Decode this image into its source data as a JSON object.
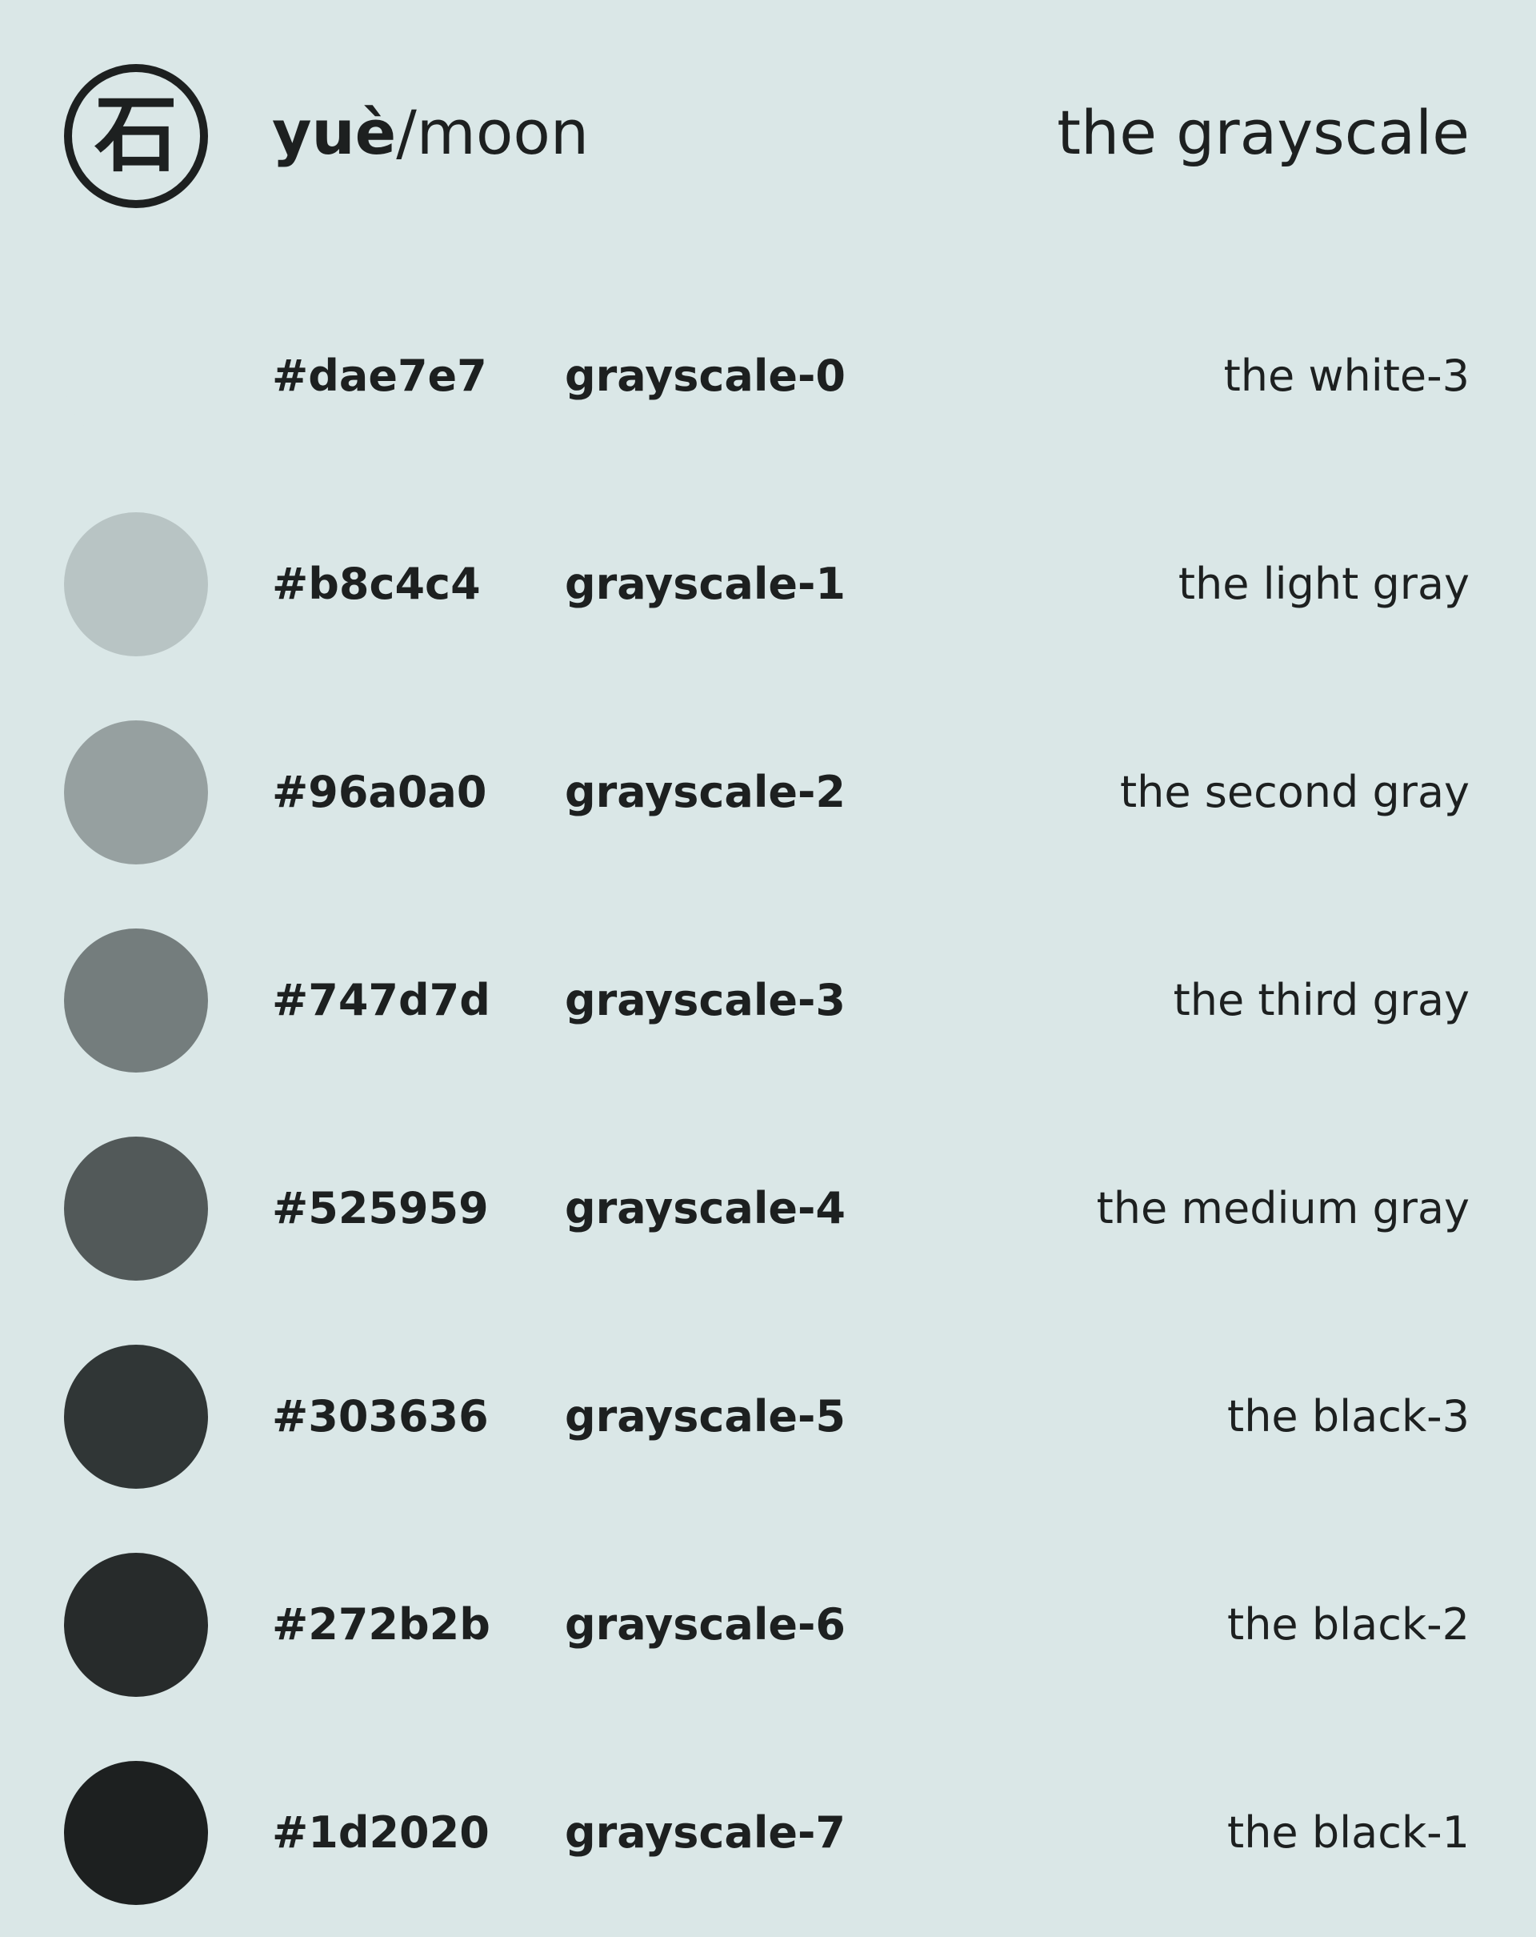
{
  "header": {
    "logo_glyph": "石",
    "brand_bold": "yuè",
    "brand_rest": "/moon",
    "title": "the grayscale"
  },
  "swatches": [
    {
      "hex": "#dae7e7",
      "token": "grayscale-0",
      "label": "the white-3",
      "color": "#dae7e7"
    },
    {
      "hex": "#b8c4c4",
      "token": "grayscale-1",
      "label": "the light gray",
      "color": "#b8c4c4"
    },
    {
      "hex": "#96a0a0",
      "token": "grayscale-2",
      "label": "the second gray",
      "color": "#96a0a0"
    },
    {
      "hex": "#747d7d",
      "token": "grayscale-3",
      "label": "the third gray",
      "color": "#747d7d"
    },
    {
      "hex": "#525959",
      "token": "grayscale-4",
      "label": "the medium gray",
      "color": "#525959"
    },
    {
      "hex": "#303636",
      "token": "grayscale-5",
      "label": "the black-3",
      "color": "#303636"
    },
    {
      "hex": "#272b2b",
      "token": "grayscale-6",
      "label": "the black-2",
      "color": "#272b2b"
    },
    {
      "hex": "#1d2020",
      "token": "grayscale-7",
      "label": "the black-1",
      "color": "#1d2020"
    }
  ]
}
